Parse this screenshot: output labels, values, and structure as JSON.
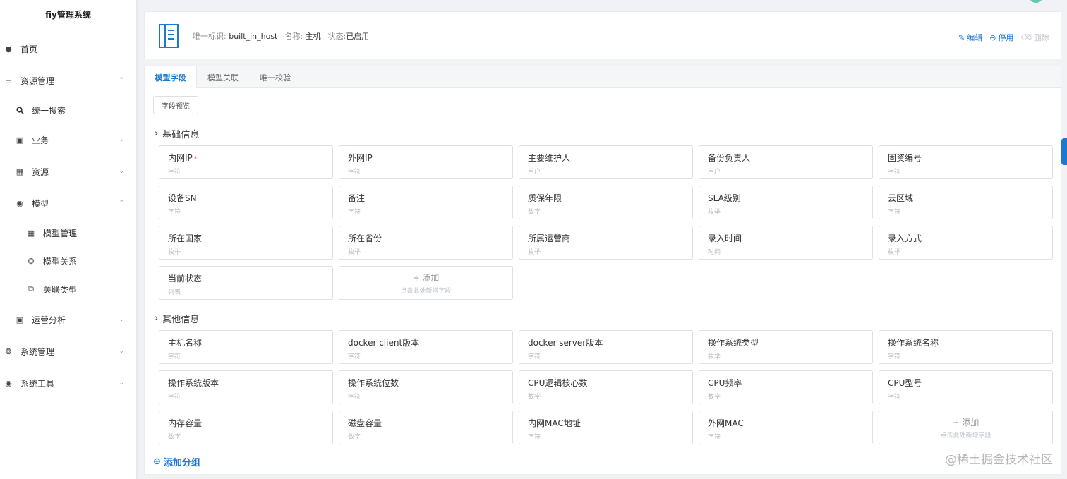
{
  "app": {
    "title": "fiy管理系统"
  },
  "sidebar": {
    "items": [
      {
        "label": "首页",
        "icon": "dashboard-icon"
      },
      {
        "label": "资源管理",
        "icon": "database-icon",
        "chevron": "up"
      },
      {
        "label": "统一搜索",
        "icon": "search-icon"
      },
      {
        "label": "业务",
        "icon": "business-icon",
        "chevron": "down"
      },
      {
        "label": "资源",
        "icon": "resource-icon",
        "chevron": "down"
      },
      {
        "label": "模型",
        "icon": "model-icon",
        "chevron": "up"
      },
      {
        "label": "模型管理",
        "icon": "table-icon"
      },
      {
        "label": "模型关系",
        "icon": "relation-icon"
      },
      {
        "label": "关联类型",
        "icon": "copy-icon"
      },
      {
        "label": "运营分析",
        "icon": "monitor-icon",
        "chevron": "down"
      },
      {
        "label": "系统管理",
        "icon": "settings-icon",
        "chevron": "down"
      },
      {
        "label": "系统工具",
        "icon": "tool-icon",
        "chevron": "down"
      }
    ]
  },
  "header": {
    "id_label": "唯一标识:",
    "id_value": "built_in_host",
    "name_label": "名称:",
    "name_value": "主机",
    "status_label": "状态:",
    "status_value": "已启用",
    "actions": {
      "edit": "编辑",
      "disable": "停用",
      "delete": "删除"
    }
  },
  "tabs": [
    {
      "label": "模型字段",
      "active": true
    },
    {
      "label": "模型关联",
      "active": false
    },
    {
      "label": "唯一校验",
      "active": false
    }
  ],
  "preview_button": "字段预览",
  "groups": [
    {
      "title": "基础信息",
      "fields": [
        {
          "name": "内网IP",
          "type": "字符",
          "required": "*"
        },
        {
          "name": "外网IP",
          "type": "字符"
        },
        {
          "name": "主要维护人",
          "type": "用户"
        },
        {
          "name": "备份负责人",
          "type": "用户"
        },
        {
          "name": "固资编号",
          "type": "字符"
        },
        {
          "name": "设备SN",
          "type": "字符"
        },
        {
          "name": "备注",
          "type": "字符"
        },
        {
          "name": "质保年限",
          "type": "数字"
        },
        {
          "name": "SLA级别",
          "type": "枚举"
        },
        {
          "name": "云区域",
          "type": "字符"
        },
        {
          "name": "所在国家",
          "type": "枚举"
        },
        {
          "name": "所在省份",
          "type": "枚举"
        },
        {
          "name": "所属运营商",
          "type": "枚举"
        },
        {
          "name": "录入时间",
          "type": "时间"
        },
        {
          "name": "录入方式",
          "type": "枚举"
        },
        {
          "name": "当前状态",
          "type": "列表"
        }
      ]
    },
    {
      "title": "其他信息",
      "fields": [
        {
          "name": "主机名称",
          "type": "字符"
        },
        {
          "name": "docker client版本",
          "type": "字符"
        },
        {
          "name": "docker server版本",
          "type": "字符"
        },
        {
          "name": "操作系统类型",
          "type": "枚举"
        },
        {
          "name": "操作系统名称",
          "type": "字符"
        },
        {
          "name": "操作系统版本",
          "type": "字符"
        },
        {
          "name": "操作系统位数",
          "type": "字符"
        },
        {
          "name": "CPU逻辑核心数",
          "type": "数字"
        },
        {
          "name": "CPU频率",
          "type": "数字"
        },
        {
          "name": "CPU型号",
          "type": "字符"
        },
        {
          "name": "内存容量",
          "type": "数字"
        },
        {
          "name": "磁盘容量",
          "type": "数字"
        },
        {
          "name": "内网MAC地址",
          "type": "字符"
        },
        {
          "name": "外网MAC",
          "type": "字符"
        }
      ]
    }
  ],
  "add_field": {
    "label": "+ 添加",
    "hint": "点击此处新增字段"
  },
  "add_group": "添加分组",
  "watermark": "@稀土掘金技术社区",
  "colors": {
    "accent": "#1e78d2",
    "required": "#f56c6c",
    "disabled": "#c0c4cc"
  }
}
